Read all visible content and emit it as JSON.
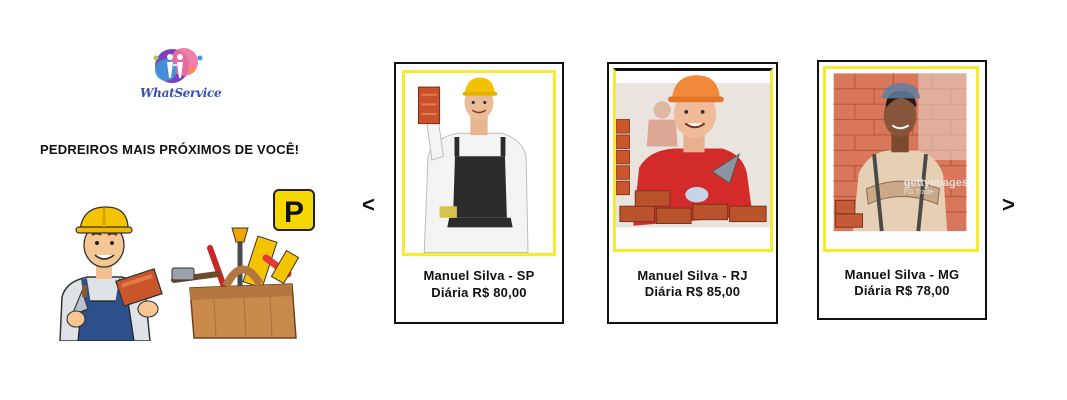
{
  "logo": {
    "text": "WhatService"
  },
  "headline": "PEDREIROS MAIS PRÓXIMOS DE VOCÊ!",
  "badge": {
    "letter": "P",
    "color": "#f5d800"
  },
  "nav": {
    "prev": "<",
    "next": ">"
  },
  "accent_color": "#f7ec2c",
  "cards": [
    {
      "name": "Manuel Silva - SP",
      "price": "Diária R$ 80,00"
    },
    {
      "name": "Manuel Silva - RJ",
      "price": "Diária R$ 85,00"
    },
    {
      "name": "Manuel Silva - MG",
      "price": "Diária R$ 78,00",
      "watermark": "gettyimages",
      "watermark_sub": "FG Trade"
    }
  ]
}
